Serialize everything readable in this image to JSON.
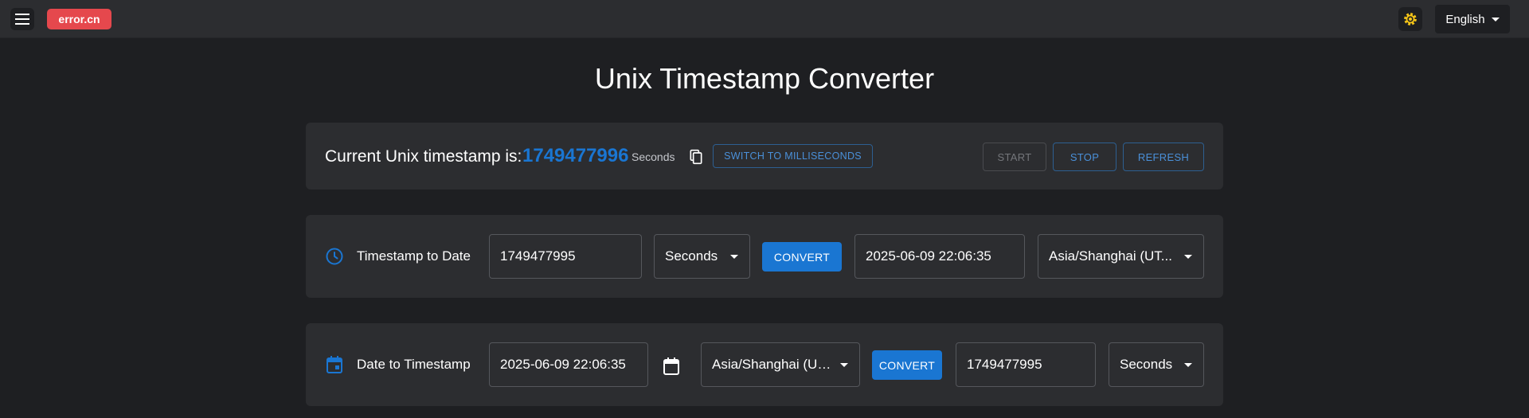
{
  "topbar": {
    "logo_text": "error.cn",
    "language": "English"
  },
  "page": {
    "title": "Unix Timestamp Converter"
  },
  "current": {
    "label": "Current Unix timestamp is:",
    "value": "1749477996",
    "unit": "Seconds",
    "switch_label": "SWITCH TO MILLISECONDS",
    "start_label": "START",
    "stop_label": "STOP",
    "refresh_label": "REFRESH"
  },
  "ts_to_date": {
    "label": "Timestamp to Date",
    "input_value": "1749477995",
    "unit": "Seconds",
    "convert_label": "CONVERT",
    "result": "2025-06-09 22:06:35",
    "timezone": "Asia/Shanghai (UT..."
  },
  "date_to_ts": {
    "label": "Date to Timestamp",
    "input_value": "2025-06-09 22:06:35",
    "timezone": "Asia/Shanghai (UT...",
    "convert_label": "CONVERT",
    "result": "1749477995",
    "unit": "Seconds"
  },
  "colors": {
    "accent": "#1a76d2",
    "logo_bg": "#e5484d",
    "theme_icon": "#f5c518",
    "background": "#1e1f22",
    "card": "#2c2d30"
  },
  "icons": {
    "menu": "menu-icon",
    "theme": "sun-gear-icon",
    "copy": "copy-icon",
    "clock": "clock-icon",
    "calendar_event": "calendar-event-icon",
    "calendar": "calendar-icon"
  }
}
